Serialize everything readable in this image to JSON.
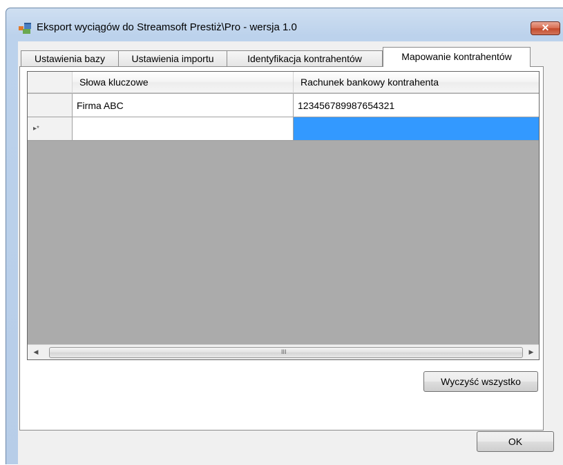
{
  "window": {
    "title": "Eksport wyciągów do Streamsoft Prestiż\\Pro - wersja 1.0",
    "close_label": "✕",
    "accent": "#3399ff"
  },
  "tabs": [
    {
      "label": "Ustawienia bazy"
    },
    {
      "label": "Ustawienia importu"
    },
    {
      "label": "Identyfikacja kontrahentów"
    },
    {
      "label": "Mapowanie kontrahentów"
    }
  ],
  "grid": {
    "columns": [
      "Słowa kluczowe",
      "Rachunek bankowy kontrahenta"
    ],
    "rows": [
      {
        "keywords": "Firma ABC",
        "account": "123456789987654321"
      }
    ],
    "new_row_indicator": "▸*",
    "scroll_grip": "III"
  },
  "buttons": {
    "clear_all": "Wyczyść wszystko",
    "ok": "OK"
  },
  "icons": {
    "app": "app-window-icon",
    "close": "close-icon",
    "scroll_left": "chevron-left-icon",
    "scroll_right": "chevron-right-icon"
  }
}
